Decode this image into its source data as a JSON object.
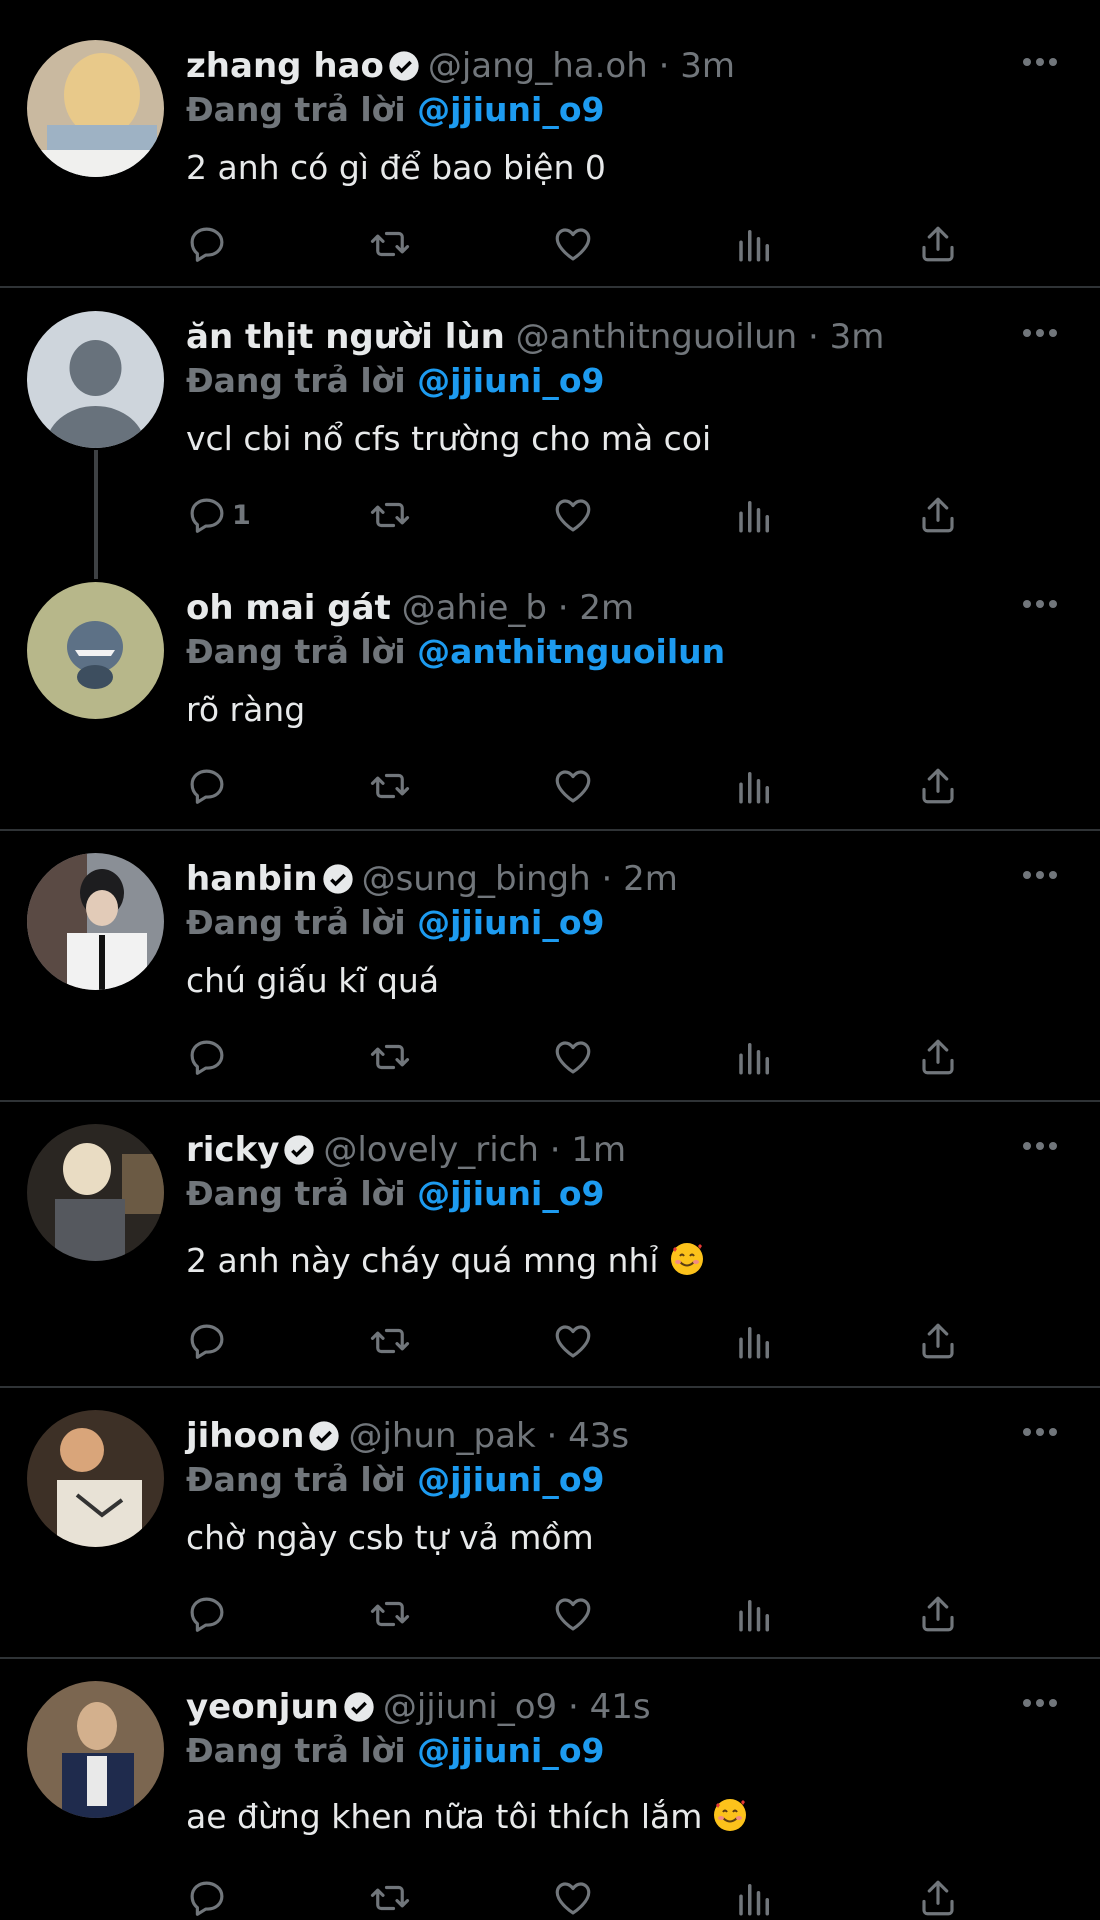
{
  "replying_label": "Đang trả lời",
  "colors": {
    "background": "#000000",
    "accent": "#1d9bf0",
    "muted": "#71767b",
    "text": "#e7e9ea",
    "divider": "#2f3336"
  },
  "tweets": [
    {
      "name": "zhang hao",
      "verified": true,
      "handle": "@jang_ha.oh",
      "time": "· 3m",
      "reply_to": "@jjiuni_o9",
      "text": "2 anh có gì để bao biện 0",
      "reply_count": ""
    },
    {
      "name": "ăn thịt người lùn",
      "verified": false,
      "handle": "@anthitnguoilun",
      "time": "· 3m",
      "reply_to": "@jjiuni_o9",
      "text": "vcl cbi nổ cfs trường cho mà coi",
      "reply_count": "1"
    },
    {
      "name": "oh mai gát",
      "verified": false,
      "handle": "@ahie_b",
      "time": "· 2m",
      "reply_to": "@anthitnguoilun",
      "text": "rõ ràng",
      "reply_count": ""
    },
    {
      "name": "hanbin",
      "verified": true,
      "handle": "@sung_bingh",
      "time": "· 2m",
      "reply_to": "@jjiuni_o9",
      "text": "chú giấu kĩ quá",
      "reply_count": ""
    },
    {
      "name": "ricky",
      "verified": true,
      "handle": "@lovely_rich",
      "time": "· 1m",
      "reply_to": "@jjiuni_o9",
      "text": "2 anh này cháy quá mng nhỉ",
      "reply_count": ""
    },
    {
      "name": "jihoon",
      "verified": true,
      "handle": "@jhun_pak",
      "time": "· 43s",
      "reply_to": "@jjiuni_o9",
      "text": "chờ ngày csb tự vả mồm",
      "reply_count": ""
    },
    {
      "name": "yeonjun",
      "verified": true,
      "handle": "@jjiuni_o9",
      "time": "· 41s",
      "reply_to": "@jjiuni_o9",
      "text": "ae đừng khen nữa tôi thích lắm",
      "reply_count": ""
    }
  ],
  "icons": {
    "reply": "reply-icon",
    "retweet": "retweet-icon",
    "like": "heart-icon",
    "views": "views-icon",
    "share": "share-icon",
    "more": "more-icon",
    "verified": "verified-icon",
    "emoji": "smiling-face-with-hearts-icon"
  }
}
